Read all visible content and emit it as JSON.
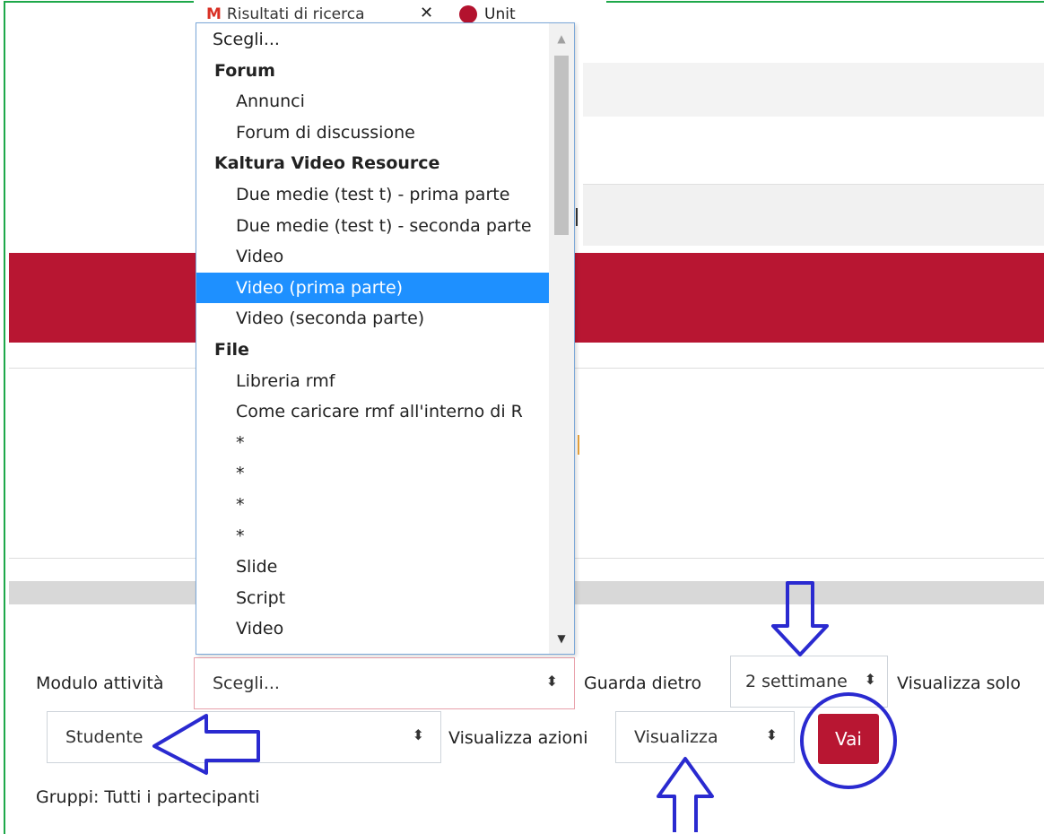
{
  "browser": {
    "tab_gmail_label": "Risultati di ricerca",
    "tab_gmail_icon": "gmail-icon",
    "tab_uni_label": "Unit",
    "tab_uni_icon": "university-icon",
    "close_glyph": "✕"
  },
  "dropdown": {
    "options": [
      {
        "label": "Scegli...",
        "kind": "first"
      },
      {
        "label": "Forum",
        "kind": "group"
      },
      {
        "label": "Annunci",
        "kind": "item"
      },
      {
        "label": "Forum di discussione",
        "kind": "item"
      },
      {
        "label": "Kaltura Video Resource",
        "kind": "group"
      },
      {
        "label": "Due medie (test t) - prima parte",
        "kind": "item"
      },
      {
        "label": "Due medie (test t) - seconda parte",
        "kind": "item"
      },
      {
        "label": "Video",
        "kind": "item"
      },
      {
        "label": "Video (prima parte)",
        "kind": "item",
        "selected": true
      },
      {
        "label": "Video (seconda parte)",
        "kind": "item"
      },
      {
        "label": "File",
        "kind": "group"
      },
      {
        "label": "Libreria rmf",
        "kind": "item"
      },
      {
        "label": "Come caricare rmf all'interno di R",
        "kind": "item"
      },
      {
        "label": "*",
        "kind": "item"
      },
      {
        "label": "*",
        "kind": "item"
      },
      {
        "label": "*",
        "kind": "item"
      },
      {
        "label": "*",
        "kind": "item"
      },
      {
        "label": "Slide",
        "kind": "item"
      },
      {
        "label": "Script",
        "kind": "item"
      },
      {
        "label": "Video",
        "kind": "item"
      }
    ],
    "scroll_up": "▲",
    "scroll_down": "▼"
  },
  "form": {
    "modulo_label": "Modulo attività",
    "modulo_value": "Scegli...",
    "guarda_label": "Guarda dietro",
    "guarda_value": "2 settimane",
    "visualizza_solo_label": "Visualizza solo",
    "ruolo_value": "Studente",
    "azioni_label": "Visualizza azioni",
    "azioni_value": "Visualizza",
    "vai_label": "Vai",
    "gruppi_label": "Gruppi: Tutti i partecipanti",
    "select_arrow": "⬍"
  },
  "colors": {
    "accent_red": "#b81632",
    "annotation_blue": "#2a2ad0",
    "highlight_blue": "#1e90ff"
  }
}
